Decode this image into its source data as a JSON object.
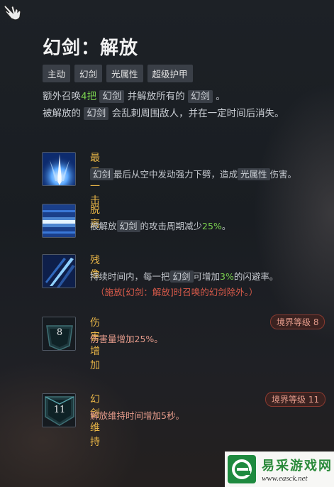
{
  "skill": {
    "title": "幻剑：解放",
    "tags": [
      "主动",
      "幻剑",
      "光属性",
      "超级护甲"
    ],
    "desc": {
      "l1a": "额外召唤",
      "count": "4把",
      "chip1": "幻剑",
      "l1b": "并解放所有的",
      "chip2": "幻剑",
      "l1c": "。",
      "l2a": "被解放的",
      "chip3": "幻剑",
      "l2b": "会乱刺周围敌人，并在一定时间后消失。"
    }
  },
  "subskills": [
    {
      "name": "最后一击",
      "chip1": "幻剑",
      "t1": "最后从空中发动强力下劈，造成",
      "chip2": "光属性",
      "t2": "伤害。"
    },
    {
      "name": "脱离",
      "t1": "被解放",
      "chip1": "幻剑",
      "t2": "的攻击周期减少",
      "value": "25%",
      "t3": "。"
    },
    {
      "name": "残像",
      "t1": "持续时间内，每一把",
      "chip1": "幻剑",
      "t2": "可增加",
      "value": "3%",
      "t3": "的闪避率。",
      "note": "（施放[幻剑：解放]时召唤的幻剑除外。）"
    },
    {
      "name": "伤害增加",
      "desc": "伤害量增加25%。",
      "badge": "境界等级 8",
      "level": "8"
    },
    {
      "name": "幻剑维持",
      "desc": "解放维持时间增加5秒。",
      "badge": "境界等级 11",
      "level": "11"
    }
  ],
  "watermark": {
    "cn": "易采游戏网",
    "url": "www.easck.net"
  },
  "colors": {
    "skill_name": "#e8b547",
    "highlight": "#7ad04f",
    "note": "#d85a4a",
    "badge_border": "#8a3a30"
  }
}
